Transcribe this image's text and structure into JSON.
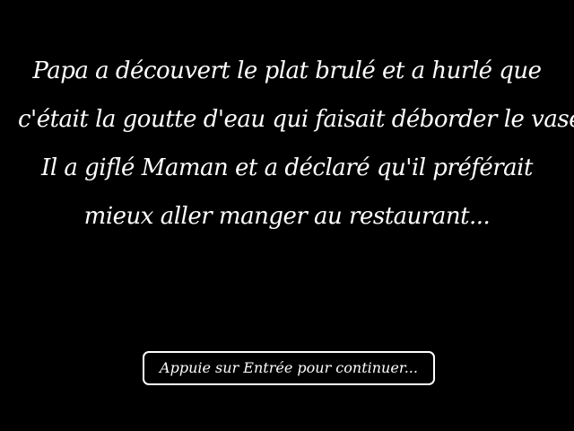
{
  "story": {
    "lines": [
      "Papa a découvert le plat brulé et a hurlé que",
      "c'était la goutte d'eau qui faisait déborder le vase.",
      "Il a giflé Maman et a déclaré qu'il préférait",
      "mieux aller manger au restaurant..."
    ]
  },
  "prompt": {
    "label": "Appuie sur Entrée pour continuer..."
  },
  "colors": {
    "background": "#000000",
    "text": "#ffffff"
  }
}
